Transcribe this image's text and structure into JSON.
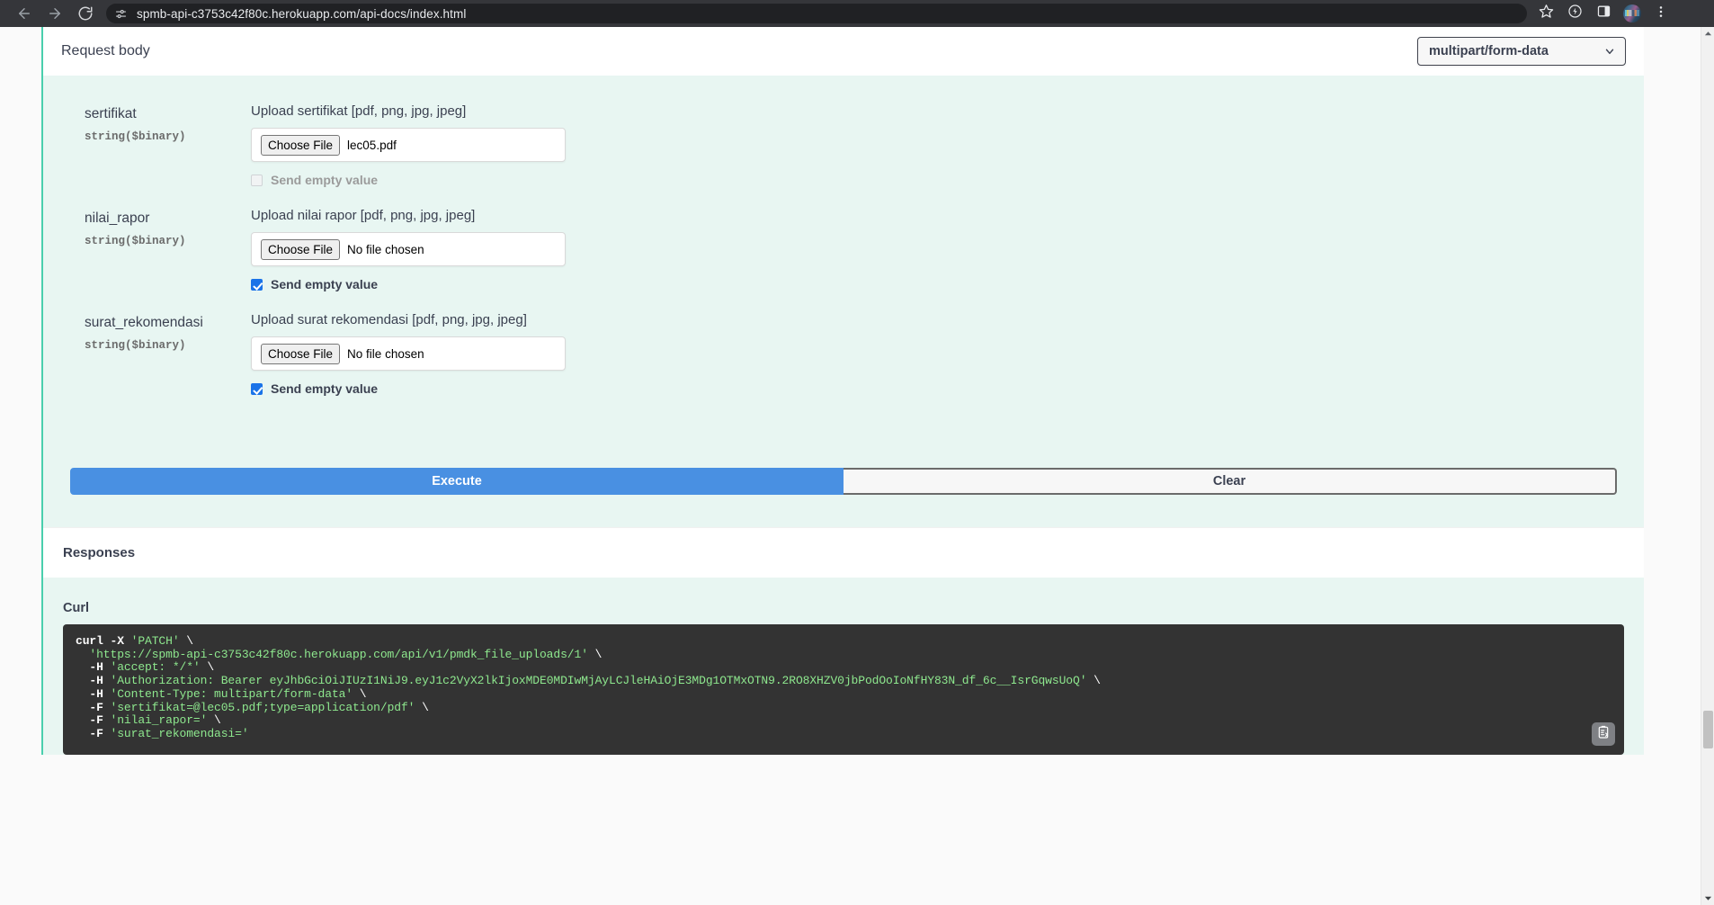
{
  "browser": {
    "back_icon": "back-arrow-icon",
    "forward_icon": "forward-arrow-icon",
    "reload_icon": "reload-icon",
    "site_info_icon": "site-settings-icon",
    "url": "spmb-api-c3753c42f80c.herokuapp.com/api-docs/index.html",
    "bookmark_icon": "star-icon",
    "energy_icon": "leaf-performance-icon",
    "sidepanel_icon": "side-panel-icon",
    "avatar_icon": "profile-avatar",
    "menu_icon": "three-dot-menu-icon"
  },
  "request_body": {
    "title": "Request body",
    "content_type": "multipart/form-data",
    "chevron_icon": "chevron-down-icon"
  },
  "parameters": [
    {
      "name": "sertifikat",
      "type": "string($binary)",
      "description": "Upload sertifikat [pdf, png, jpg, jpeg]",
      "choose_file_label": "Choose File",
      "file_value": "lec05.pdf",
      "send_empty_label": "Send empty value",
      "send_empty_checked": false,
      "send_empty_disabled": true
    },
    {
      "name": "nilai_rapor",
      "type": "string($binary)",
      "description": "Upload nilai rapor [pdf, png, jpg, jpeg]",
      "choose_file_label": "Choose File",
      "file_value": "No file chosen",
      "send_empty_label": "Send empty value",
      "send_empty_checked": true,
      "send_empty_disabled": false
    },
    {
      "name": "surat_rekomendasi",
      "type": "string($binary)",
      "description": "Upload surat rekomendasi [pdf, png, jpg, jpeg]",
      "choose_file_label": "Choose File",
      "file_value": "No file chosen",
      "send_empty_label": "Send empty value",
      "send_empty_checked": true,
      "send_empty_disabled": false
    }
  ],
  "actions": {
    "execute_label": "Execute",
    "clear_label": "Clear"
  },
  "responses": {
    "title": "Responses",
    "curl_label": "Curl",
    "copy_icon": "copy-to-clipboard-icon",
    "curl_lines": [
      "curl -X 'PATCH' \\",
      "  'https://spmb-api-c3753c42f80c.herokuapp.com/api/v1/pmdk_file_uploads/1' \\",
      "  -H 'accept: */*' \\",
      "  -H 'Authorization: Bearer eyJhbGciOiJIUzI1NiJ9.eyJ1c2VyX2lkIjoxMDE0MDIwMjAyLCJleHAiOjE3MDg1OTMxOTN9.2RO8XHZV0jbPodOoIoNfHY83N_df_6c__IsrGqwsUoQ' \\",
      "  -H 'Content-Type: multipart/form-data' \\",
      "  -F 'sertifikat=@lec05.pdf;type=application/pdf' \\",
      "  -F 'nilai_rapor=' \\",
      "  -F 'surat_rekomendasi='"
    ]
  },
  "scrollbar": {
    "up_icon": "scroll-up-arrow-icon",
    "down_icon": "scroll-down-arrow-icon",
    "thumb": "scrollbar-thumb"
  },
  "colors": {
    "accent_teal": "#49cfad",
    "execute_blue": "#4990e2",
    "checkbox_blue": "#1a73e8",
    "body_mint": "#e8f6f2",
    "code_bg": "#333333",
    "code_green": "#8ee88e"
  }
}
